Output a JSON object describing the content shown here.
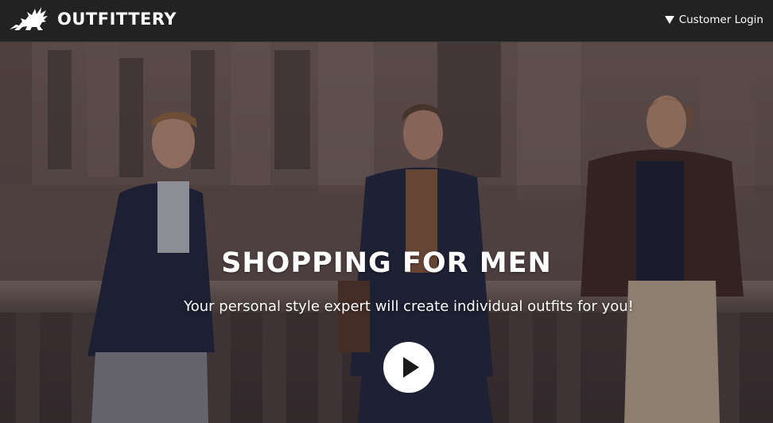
{
  "header": {
    "brand": "OUTFITTERY",
    "login_label": "Customer Login"
  },
  "hero": {
    "headline": "SHOPPING FOR MEN",
    "subline": "Your personal style expert will create individual outfits for you!"
  },
  "icons": {
    "logo": "griffin-logo-icon",
    "login_toggle": "triangle-down-icon",
    "play": "play-icon"
  },
  "colors": {
    "topbar": "#222222",
    "text": "#ffffff",
    "play_button": "#ffffff"
  }
}
